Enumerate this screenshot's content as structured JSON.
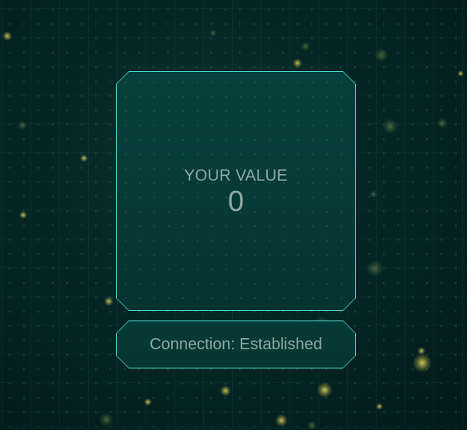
{
  "value_panel": {
    "label": "YOUR VALUE",
    "value": "0"
  },
  "status_panel": {
    "text": "Connection: Established"
  },
  "colors": {
    "background": "#052625",
    "panel_border": "#4fd8cc",
    "panel_fill": "#063a37",
    "text": "#8fa9a6",
    "particle": "#dcd25a"
  }
}
